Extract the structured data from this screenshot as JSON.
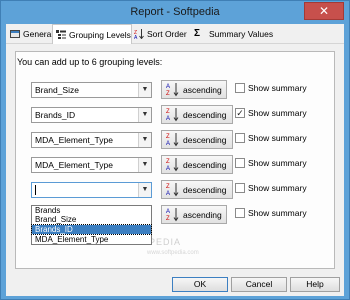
{
  "window": {
    "title": "Report - Softpedia",
    "close_glyph": "✕"
  },
  "tabs": [
    {
      "label": "General",
      "icon": "general-icon"
    },
    {
      "label": "Grouping Levels",
      "icon": "grouping-icon"
    },
    {
      "label": "Sort Order",
      "icon": "sort-icon"
    },
    {
      "label": "Summary Values",
      "icon": "sigma-icon",
      "glyph": "Σ"
    }
  ],
  "heading": "You can add up to 6 grouping levels:",
  "rows": [
    {
      "field": "Brand_Size",
      "sort": "ascending",
      "show_summary": false
    },
    {
      "field": "Brands_ID",
      "sort": "descending",
      "show_summary": true
    },
    {
      "field": "MDA_Element_Type",
      "sort": "descending",
      "show_summary": false
    },
    {
      "field": "MDA_Element_Type",
      "sort": "descending",
      "show_summary": false
    },
    {
      "field": "",
      "sort": "descending",
      "show_summary": false
    },
    {
      "field": "",
      "sort": "ascending",
      "show_summary": false
    }
  ],
  "show_summary_label": "Show summary",
  "dropdown": {
    "options": [
      "Brands",
      "Brand_Size",
      "Brands_ID",
      "MDA_Element_Type"
    ],
    "selected": "Brands_ID"
  },
  "footer": {
    "ok": "OK",
    "cancel": "Cancel",
    "help": "Help"
  },
  "watermark": {
    "text": "SOFTPEDIA",
    "sub": "www.softpedia.com"
  },
  "colors": {
    "accent": "#3c7fc1",
    "titlebar": "#5da2d8",
    "close": "#c7504c"
  }
}
